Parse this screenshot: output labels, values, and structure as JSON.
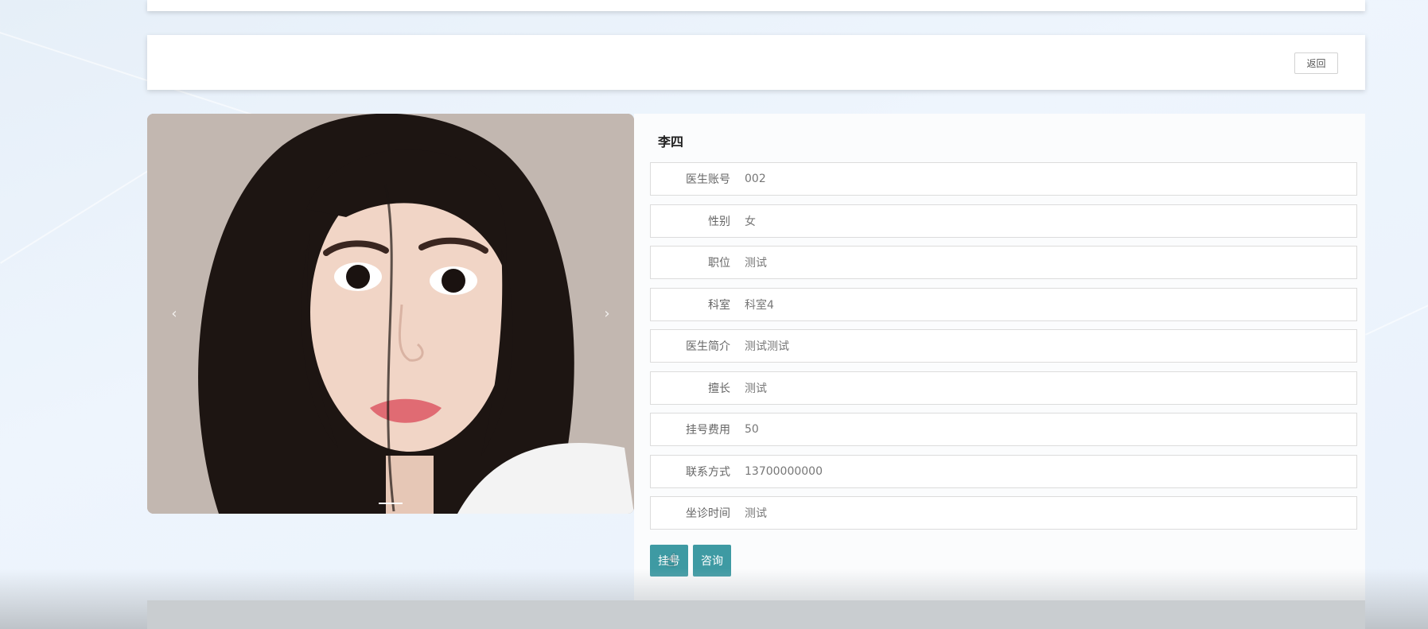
{
  "toolbar": {
    "back_label": "返回"
  },
  "carousel": {
    "prev_symbol": "‹",
    "next_symbol": "›",
    "slide_count": 1,
    "active_slide": 1
  },
  "doctor": {
    "name": "李四",
    "fields": [
      {
        "label": "医生账号",
        "value": "002"
      },
      {
        "label": "性别",
        "value": "女"
      },
      {
        "label": "职位",
        "value": "测试"
      },
      {
        "label": "科室",
        "value": "科室4"
      },
      {
        "label": "医生简介",
        "value": "测试测试"
      },
      {
        "label": "擅长",
        "value": "测试"
      },
      {
        "label": "挂号费用",
        "value": "50"
      },
      {
        "label": "联系方式",
        "value": "13700000000"
      },
      {
        "label": "坐诊时间",
        "value": "测试"
      }
    ]
  },
  "actions": {
    "register_label": "挂号",
    "consult_label": "咨询"
  },
  "colors": {
    "accent": "#3e9aa3",
    "background": "#eaf2fb"
  }
}
